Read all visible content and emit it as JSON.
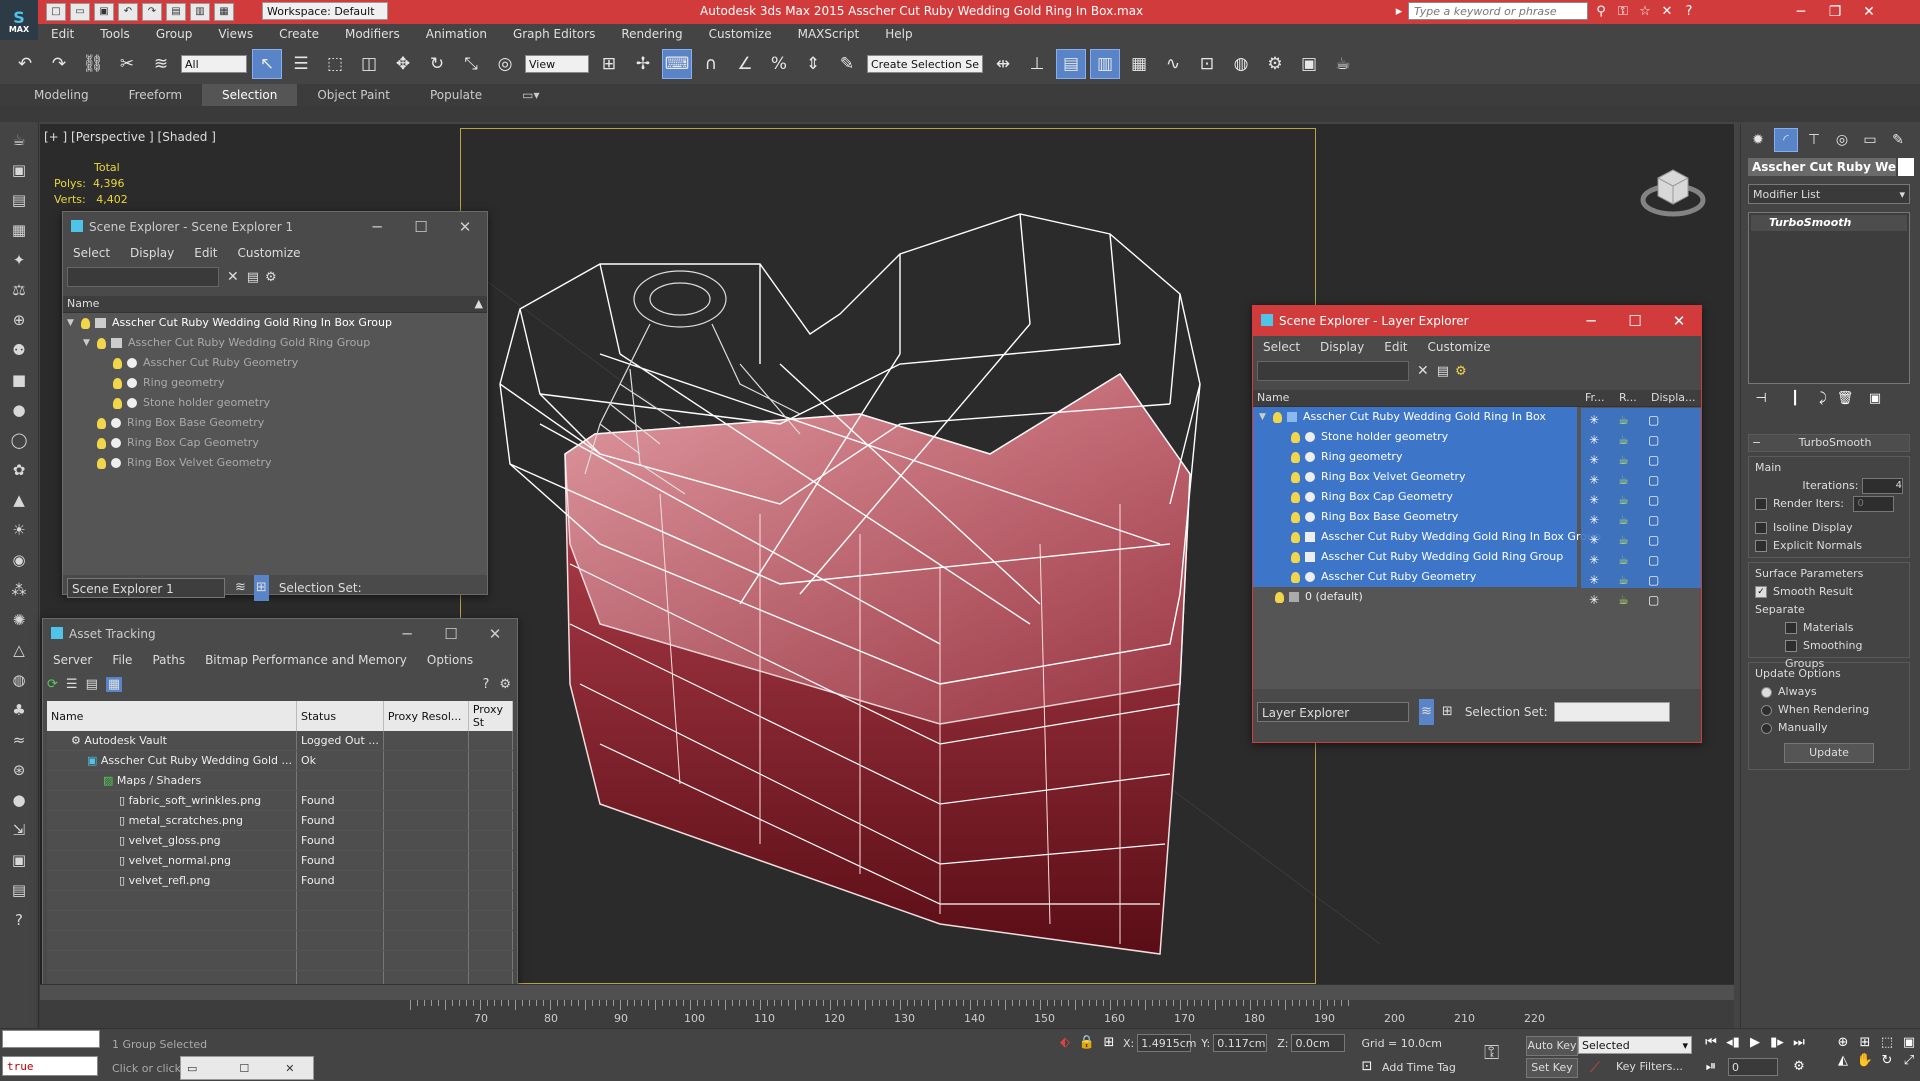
{
  "app": {
    "title": "Autodesk 3ds Max  2015    Asscher Cut Ruby Wedding Gold Ring In Box.max",
    "workspace": "Workspace: Default",
    "search_placeholder": "Type a keyword or phrase"
  },
  "menu": [
    "Edit",
    "Tools",
    "Group",
    "Views",
    "Create",
    "Modifiers",
    "Animation",
    "Graph Editors",
    "Rendering",
    "Customize",
    "MAXScript",
    "Help"
  ],
  "toolbar": {
    "selection_filter": "All",
    "ref_coord": "View",
    "named_selection_placeholder": "Create Selection Se"
  },
  "ribbon_tabs": [
    "Modeling",
    "Freeform",
    "Selection",
    "Object Paint",
    "Populate"
  ],
  "ribbon_active": "Selection",
  "viewport": {
    "label": "[+ ] [Perspective ] [Shaded ]",
    "stats_header": "Total",
    "polys_label": "Polys:",
    "polys": "4,396",
    "verts_label": "Verts:",
    "verts": "4,402"
  },
  "scene_explorer": {
    "title": "Scene Explorer - Scene Explorer 1",
    "menu": [
      "Select",
      "Display",
      "Edit",
      "Customize"
    ],
    "column": "Name",
    "rows": [
      {
        "label": "Asscher Cut Ruby Wedding Gold Ring In Box Group",
        "level": 0,
        "expand": "▼",
        "type": "group"
      },
      {
        "label": "Asscher Cut Ruby Wedding Gold Ring Group",
        "level": 1,
        "expand": "▼",
        "type": "group"
      },
      {
        "label": "Asscher Cut Ruby Geometry",
        "level": 2,
        "expand": "",
        "type": "obj"
      },
      {
        "label": "Ring geometry",
        "level": 2,
        "expand": "",
        "type": "obj"
      },
      {
        "label": "Stone holder geometry",
        "level": 2,
        "expand": "",
        "type": "obj"
      },
      {
        "label": "Ring Box Base Geometry",
        "level": 1,
        "expand": "",
        "type": "obj"
      },
      {
        "label": "Ring Box Cap Geometry",
        "level": 1,
        "expand": "",
        "type": "obj"
      },
      {
        "label": "Ring Box Velvet Geometry",
        "level": 1,
        "expand": "",
        "type": "obj"
      }
    ],
    "footer_name": "Scene Explorer 1",
    "selection_set_label": "Selection Set:"
  },
  "layer_explorer": {
    "title": "Scene Explorer - Layer Explorer",
    "menu": [
      "Select",
      "Display",
      "Edit",
      "Customize"
    ],
    "columns": [
      "Name",
      "Fr...",
      "R...",
      "Displa..."
    ],
    "rows": [
      {
        "label": "Asscher Cut Ruby Wedding Gold Ring In Box",
        "level": 0,
        "expand": "▼",
        "type": "layer",
        "sel": true
      },
      {
        "label": "Stone holder geometry",
        "level": 1,
        "expand": "",
        "type": "obj",
        "sel": true
      },
      {
        "label": "Ring geometry",
        "level": 1,
        "expand": "",
        "type": "obj",
        "sel": true
      },
      {
        "label": "Ring Box Velvet Geometry",
        "level": 1,
        "expand": "",
        "type": "obj",
        "sel": true
      },
      {
        "label": "Ring Box Cap Geometry",
        "level": 1,
        "expand": "",
        "type": "obj",
        "sel": true
      },
      {
        "label": "Ring Box Base Geometry",
        "level": 1,
        "expand": "",
        "type": "obj",
        "sel": true
      },
      {
        "label": "Asscher Cut Ruby Wedding Gold Ring In Box Group",
        "level": 1,
        "expand": "",
        "type": "group",
        "sel": true
      },
      {
        "label": "Asscher Cut Ruby Wedding Gold Ring Group",
        "level": 1,
        "expand": "",
        "type": "group",
        "sel": true
      },
      {
        "label": "Asscher Cut Ruby Geometry",
        "level": 1,
        "expand": "",
        "type": "obj",
        "sel": true
      },
      {
        "label": "0 (default)",
        "level": 0,
        "expand": "",
        "type": "layer",
        "sel": false
      }
    ],
    "footer_name": "Layer Explorer",
    "selection_set_label": "Selection Set:"
  },
  "asset_tracking": {
    "title": "Asset Tracking",
    "menu": [
      "Server",
      "File",
      "Paths",
      "Bitmap Performance and Memory",
      "Options"
    ],
    "columns": [
      "Name",
      "Status",
      "Proxy Resol...",
      "Proxy St"
    ],
    "rows": [
      {
        "name": "Autodesk Vault",
        "status": "Logged Out ...",
        "level": 0
      },
      {
        "name": "Asscher Cut Ruby Wedding Gold ...",
        "status": "Ok",
        "level": 1
      },
      {
        "name": "Maps / Shaders",
        "status": "",
        "level": 2
      },
      {
        "name": "fabric_soft_wrinkles.png",
        "status": "Found",
        "level": 3
      },
      {
        "name": "metal_scratches.png",
        "status": "Found",
        "level": 3
      },
      {
        "name": "velvet_gloss.png",
        "status": "Found",
        "level": 3
      },
      {
        "name": "velvet_normal.png",
        "status": "Found",
        "level": 3
      },
      {
        "name": "velvet_refl.png",
        "status": "Found",
        "level": 3
      }
    ]
  },
  "command_panel": {
    "object_name": "Asscher Cut Ruby Weddin",
    "modifier_list": "Modifier List",
    "stack": [
      "TurboSmooth"
    ],
    "rollout_title": "TurboSmooth",
    "main_label": "Main",
    "iterations_label": "Iterations:",
    "iterations": "4",
    "render_iters_label": "Render Iters:",
    "render_iters": "0",
    "isoline": "Isoline Display",
    "explicit_normals": "Explicit Normals",
    "surface_params": "Surface Parameters",
    "smooth_result": "Smooth Result",
    "separate": "Separate",
    "materials": "Materials",
    "smoothing_groups": "Smoothing Groups",
    "update_options": "Update Options",
    "always": "Always",
    "when_rendering": "When Rendering",
    "manually": "Manually",
    "update_button": "Update"
  },
  "timeline": {
    "ticks": [
      "70",
      "80",
      "90",
      "100",
      "110",
      "120",
      "130",
      "140",
      "150",
      "160",
      "170",
      "180",
      "190",
      "200",
      "210",
      "220"
    ]
  },
  "status": {
    "script_text": "true",
    "selection_status": "1 Group Selected",
    "prompt": "Click or click",
    "x_label": "X:",
    "x": "1.4915cm",
    "y_label": "Y:",
    "y": "0.117cm",
    "z_label": "Z:",
    "z": "0.0cm",
    "grid": "Grid = 10.0cm",
    "add_time_tag": "Add Time Tag",
    "auto_key": "Auto Key",
    "set_key": "Set Key",
    "key_mode": "Selected",
    "key_filters": "Key Filters...",
    "frame": "0"
  }
}
